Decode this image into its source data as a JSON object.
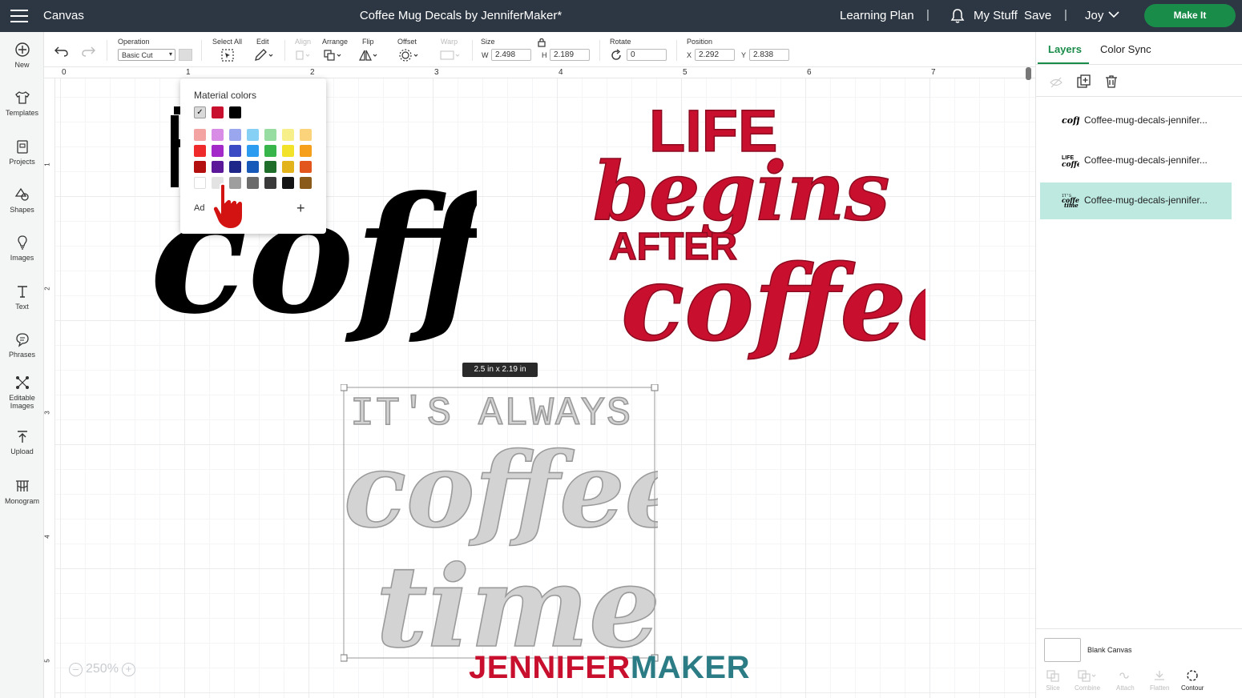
{
  "topbar": {
    "app_name": "Canvas",
    "title": "Coffee Mug Decals by JenniferMaker*",
    "learning_plan": "Learning Plan",
    "separator": "|",
    "my_stuff": "My Stuff",
    "save": "Save",
    "user": "Joy",
    "make_it": "Make It"
  },
  "sidebar": {
    "items": [
      {
        "label": "New",
        "icon": "plus-circle-icon"
      },
      {
        "label": "Templates",
        "icon": "shirt-icon"
      },
      {
        "label": "Projects",
        "icon": "project-icon"
      },
      {
        "label": "Shapes",
        "icon": "shapes-icon"
      },
      {
        "label": "Images",
        "icon": "bulb-icon"
      },
      {
        "label": "Text",
        "icon": "text-icon"
      },
      {
        "label": "Phrases",
        "icon": "speech-bubble-icon"
      },
      {
        "label": "Editable",
        "label2": "Images",
        "icon": "editable-images-icon"
      },
      {
        "label": "Upload",
        "icon": "upload-icon"
      },
      {
        "label": "Monogram",
        "icon": "monogram-icon"
      }
    ]
  },
  "toolbar": {
    "operation_label": "Operation",
    "operation_value": "Basic Cut",
    "select_all": "Select All",
    "edit": "Edit",
    "align": "Align",
    "arrange": "Arrange",
    "flip": "Flip",
    "offset": "Offset",
    "warp": "Warp",
    "size": "Size",
    "w_label": "W",
    "w_value": "2.498",
    "h_label": "H",
    "h_value": "2.189",
    "rotate": "Rotate",
    "rotate_value": "0",
    "position": "Position",
    "x_label": "X",
    "x_value": "2.292",
    "y_label": "Y",
    "y_value": "2.838"
  },
  "rulers": {
    "top": [
      "0",
      "1",
      "2",
      "3",
      "4",
      "5",
      "6",
      "7"
    ],
    "left": [
      "1",
      "2",
      "3",
      "4",
      "5"
    ]
  },
  "color_popup": {
    "title": "Material colors",
    "add_label": "Ad",
    "material_colors": [
      "#d9d9d9",
      "#c8102e",
      "#000000"
    ],
    "palette": [
      [
        "#f4a3a3",
        "#d98ce6",
        "#9aa6ee",
        "#86cff5",
        "#97dca0",
        "#f7f08a",
        "#fbd37a"
      ],
      [
        "#ee2a2a",
        "#a429c9",
        "#3a4bc4",
        "#2b9cf0",
        "#38b54a",
        "#f2e229",
        "#f59f1a"
      ],
      [
        "#b30f0f",
        "#5b1899",
        "#1e2789",
        "#1759b8",
        "#1e6e2a",
        "#e3b31b",
        "#e2561e"
      ],
      [
        "#ffffff",
        "#e3e3e3",
        "#9e9e9e",
        "#6b6b6b",
        "#3a3a3a",
        "#141414",
        "#8a5a1a"
      ]
    ]
  },
  "artwork": {
    "left_word": "coffee",
    "right_line1": "LIFE",
    "right_line2": "begins",
    "right_line3": "AFTER",
    "right_line4": "coffee",
    "bottom_line1": "IT'S ALWAYS",
    "bottom_line2": "coffee",
    "bottom_line3": "time",
    "size_badge": "2.5  in x 2.19  in"
  },
  "zoom": {
    "value": "250%",
    "minus": "–",
    "plus": "+"
  },
  "brand": {
    "part1": "JENNIFER",
    "part2": "MAKER",
    "color1": "#c8102e",
    "color2": "#2c7c86"
  },
  "right_panel": {
    "tab_layers": "Layers",
    "tab_color_sync": "Color Sync",
    "layers": [
      "Coffee-mug-decals-jennifer...",
      "Coffee-mug-decals-jennifer...",
      "Coffee-mug-decals-jennifer..."
    ],
    "blank_canvas": "Blank Canvas",
    "tools": [
      "Slice",
      "Combine",
      "Attach",
      "Flatten",
      "Contour"
    ]
  }
}
